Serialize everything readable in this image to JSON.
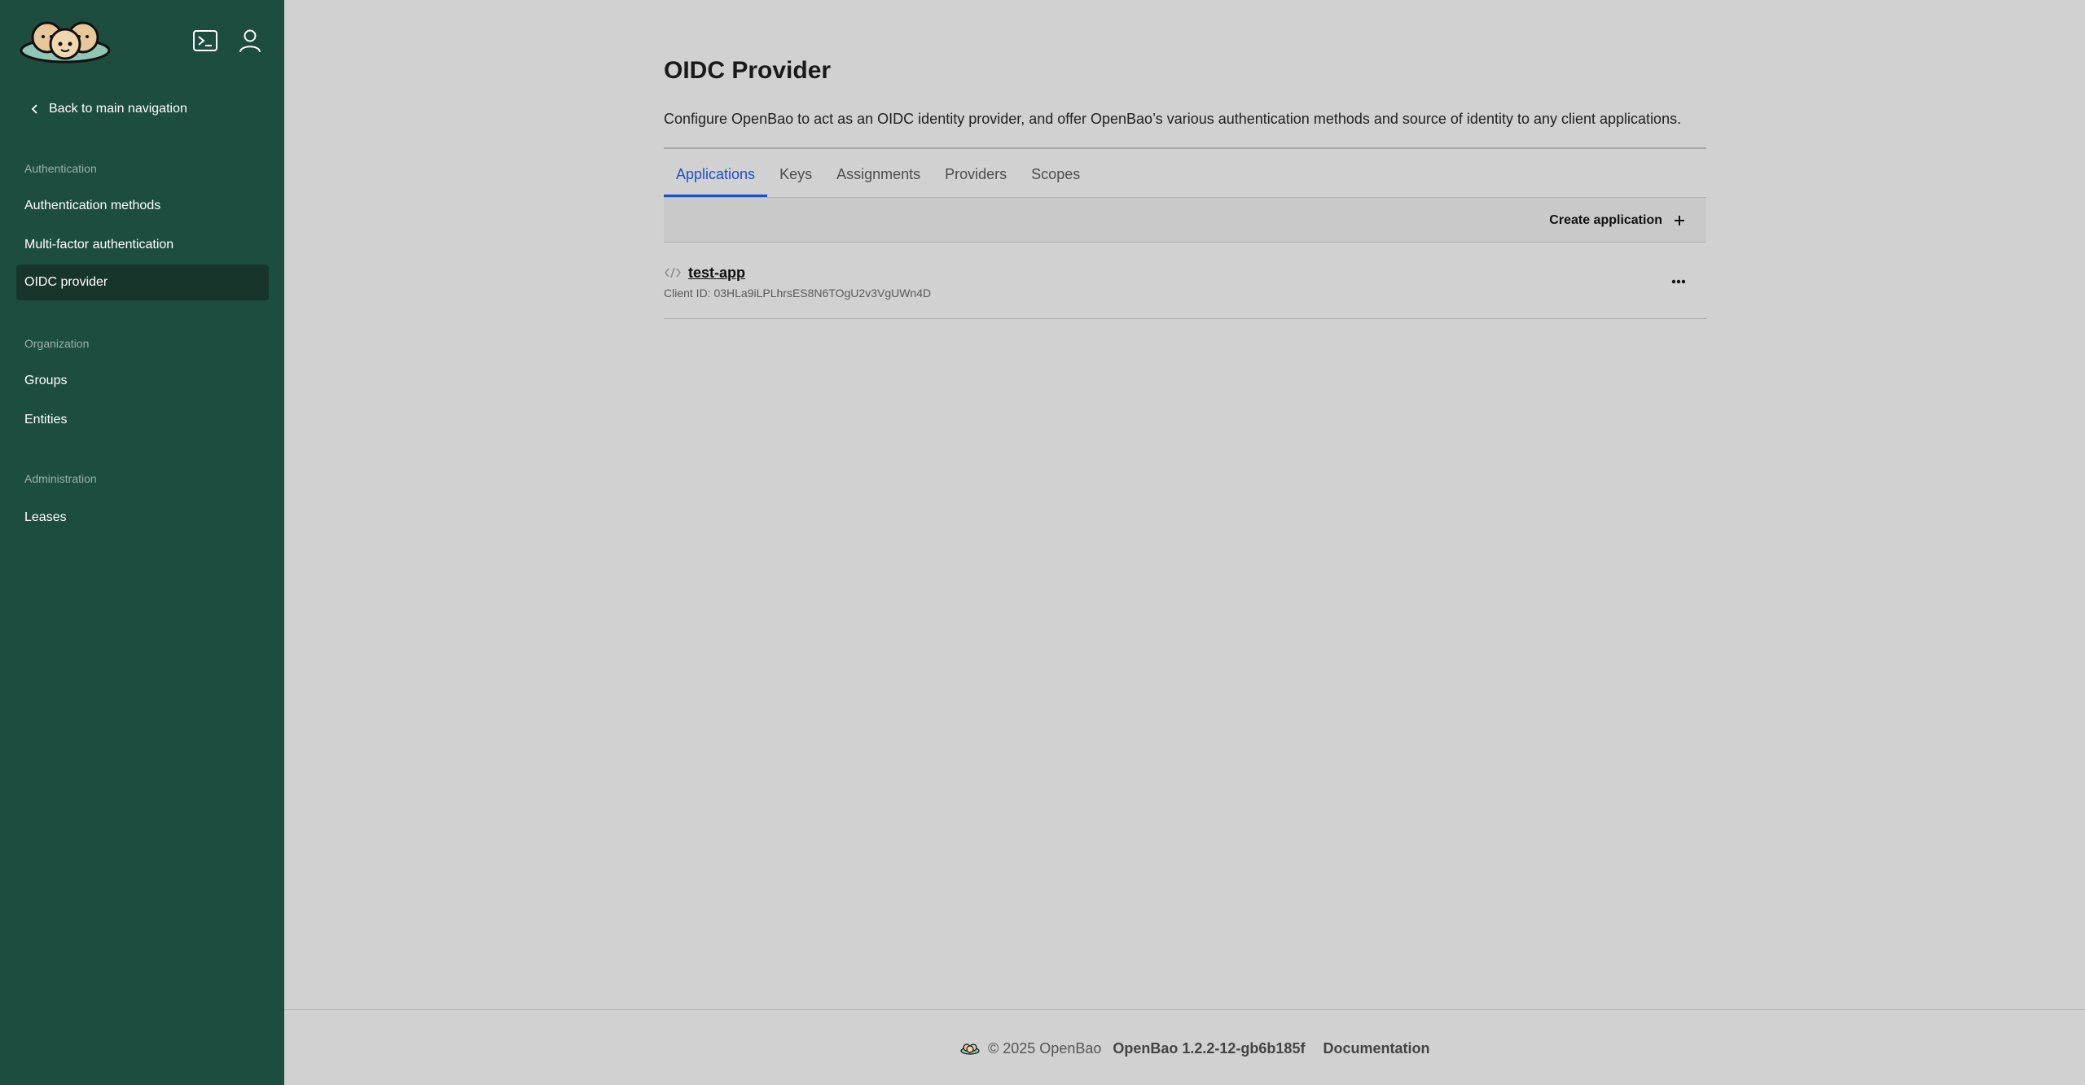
{
  "sidebar": {
    "back_label": "Back to main navigation",
    "sections": [
      {
        "title": "Authentication",
        "items": [
          "Authentication methods",
          "Multi-factor authentication",
          "OIDC provider"
        ]
      },
      {
        "title": "Organization",
        "items": [
          "Groups",
          "Entities"
        ]
      },
      {
        "title": "Administration",
        "items": [
          "Leases"
        ]
      }
    ],
    "active_item": "OIDC provider"
  },
  "header_icons": [
    "terminal-icon",
    "user-icon"
  ],
  "page": {
    "title": "OIDC Provider",
    "description": "Configure OpenBao to act as an OIDC identity provider, and offer OpenBao’s various authentication methods and source of identity to any client applications.",
    "tabs": [
      "Applications",
      "Keys",
      "Assignments",
      "Providers",
      "Scopes"
    ],
    "active_tab": "Applications",
    "create_label": "Create application",
    "applications": [
      {
        "name": "test-app",
        "client_id_text": "Client ID: 03HLa9iLPLhrsES8N6TOgU2v3VgUWn4D"
      }
    ]
  },
  "footer": {
    "copyright": "© 2025 OpenBao",
    "version": "OpenBao 1.2.2-12-gb6b185f",
    "documentation": "Documentation"
  },
  "colors": {
    "sidebar_bg": "#1d4d3e",
    "sidebar_active": "#17352b",
    "main_bg": "#d1d1d1",
    "accent": "#1b4fd1"
  }
}
